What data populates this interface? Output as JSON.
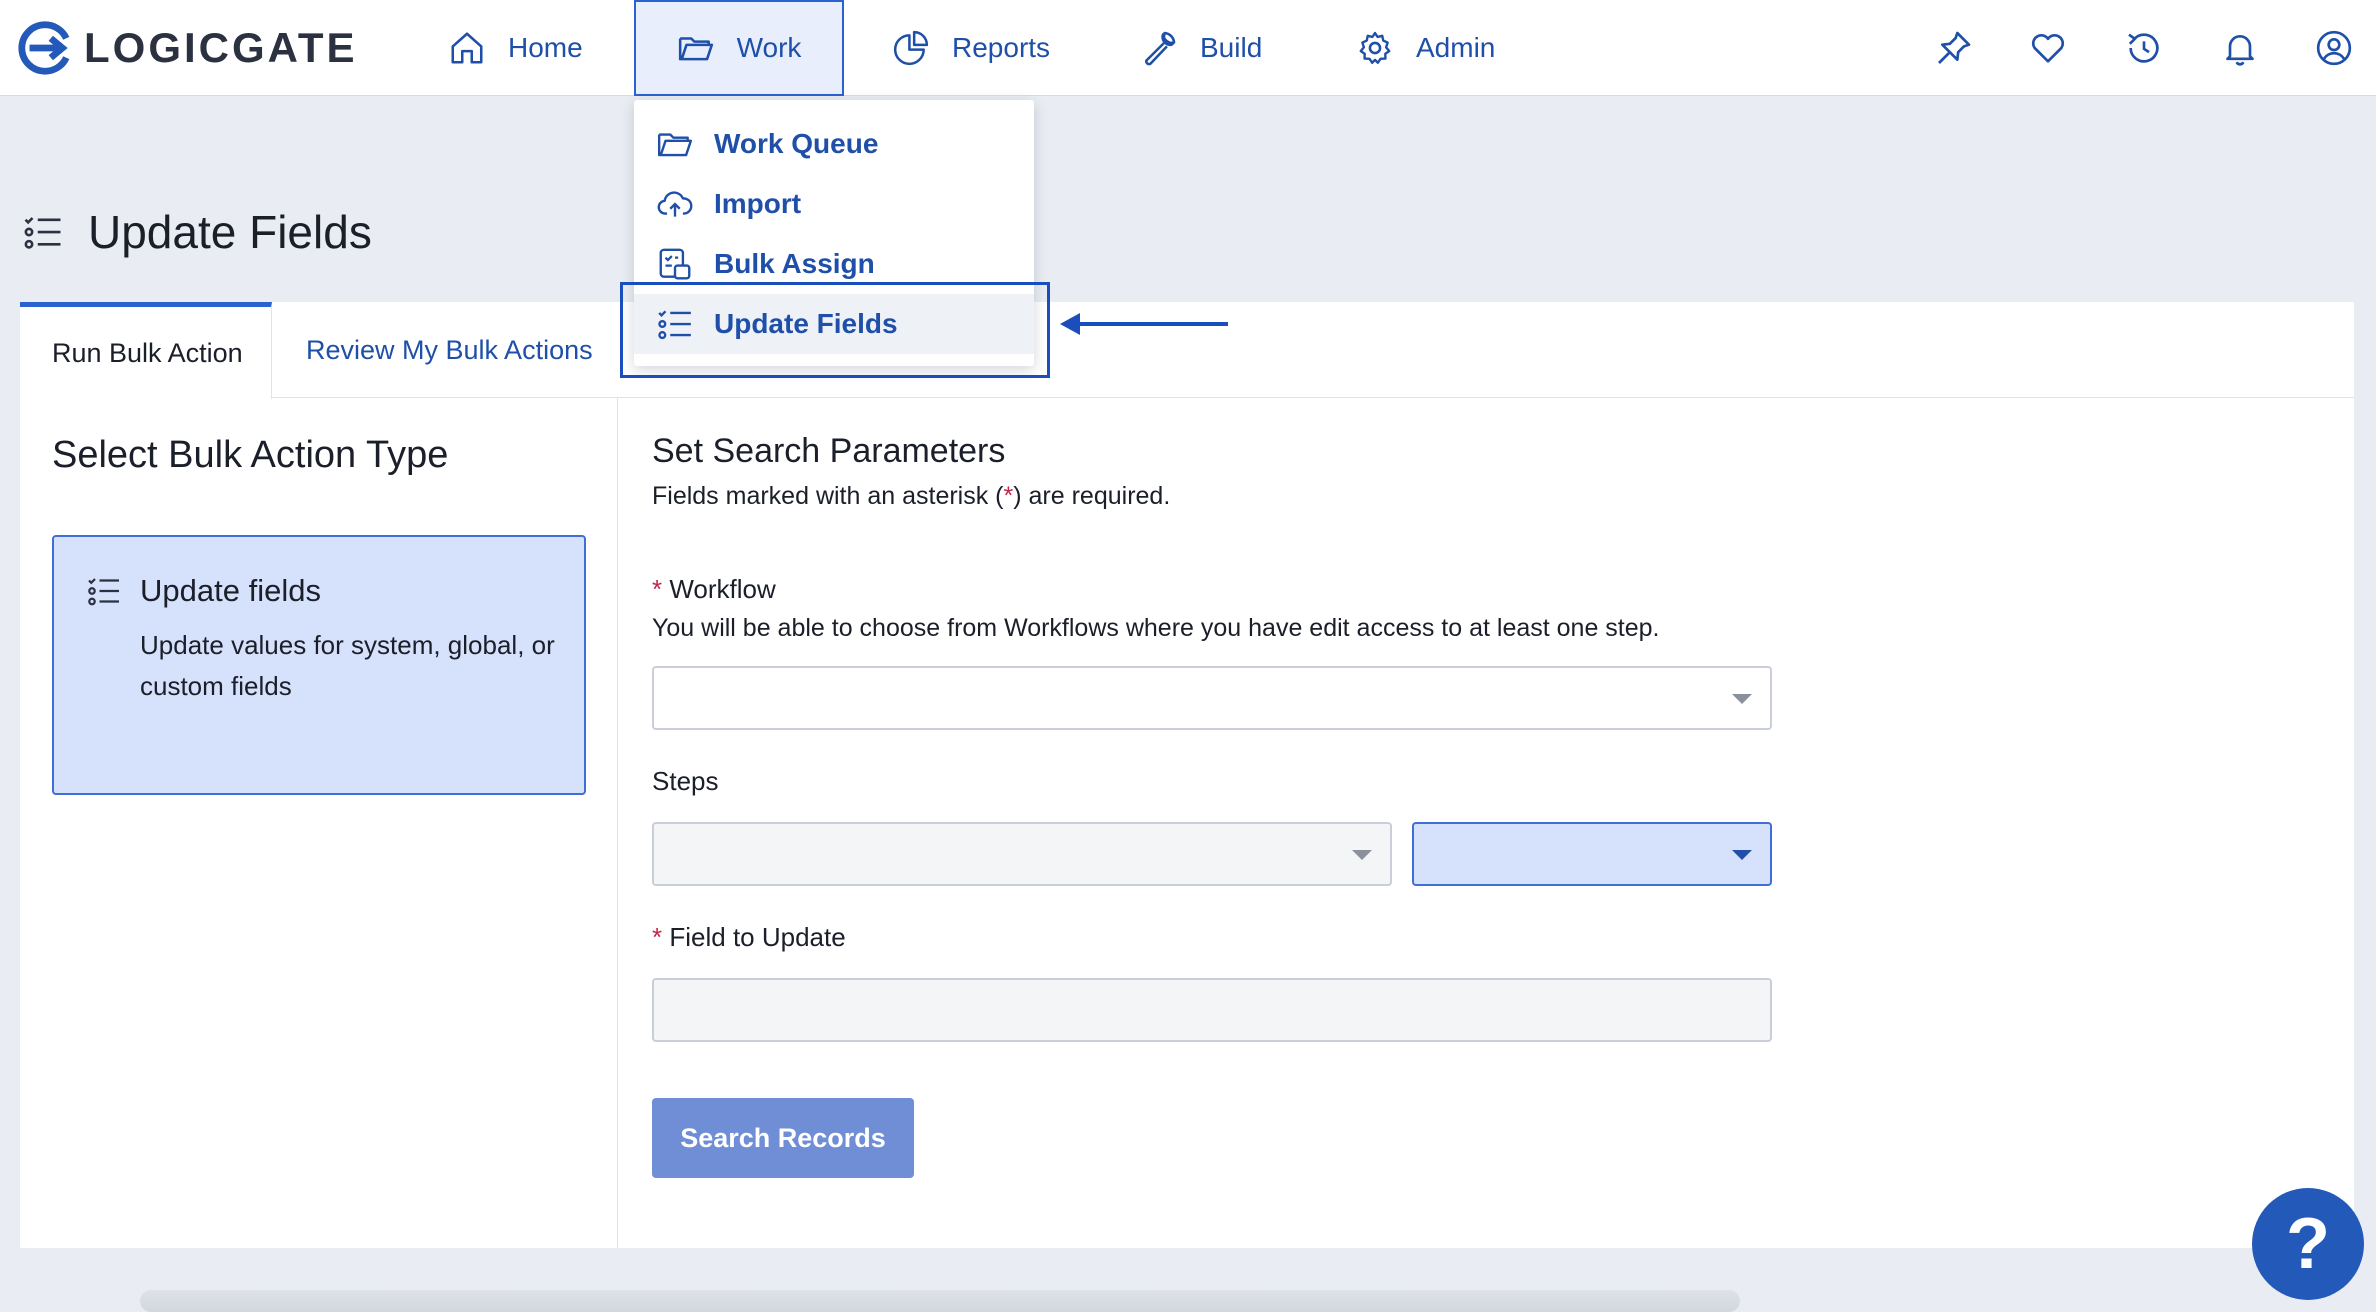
{
  "brand": {
    "name": "LOGICGATE"
  },
  "nav": {
    "items": [
      {
        "label": "Home",
        "icon": "home-icon"
      },
      {
        "label": "Work",
        "icon": "folder-icon",
        "active": true
      },
      {
        "label": "Reports",
        "icon": "pie-chart-icon"
      },
      {
        "label": "Build",
        "icon": "wrench-icon"
      },
      {
        "label": "Admin",
        "icon": "gear-icon"
      }
    ],
    "right_icons": [
      "pin-icon",
      "heart-icon",
      "history-icon",
      "bell-icon",
      "user-icon"
    ]
  },
  "work_menu": {
    "items": [
      {
        "label": "Work Queue",
        "icon": "folder-icon"
      },
      {
        "label": "Import",
        "icon": "cloud-upload-icon"
      },
      {
        "label": "Bulk Assign",
        "icon": "bulk-assign-icon"
      },
      {
        "label": "Update Fields",
        "icon": "checklist-icon",
        "highlighted": true
      }
    ]
  },
  "page": {
    "title": "Update Fields",
    "tabs": [
      "Run Bulk Action",
      "Review My Bulk Actions"
    ]
  },
  "left": {
    "heading": "Select Bulk Action Type",
    "card_title": "Update fields",
    "card_desc": "Update values for system, global, or custom fields"
  },
  "right": {
    "section_title": "Set Search Parameters",
    "required_note_pre": "Fields marked with an asterisk (",
    "required_note_star": "*",
    "required_note_post": ") are required.",
    "asterisk": "*",
    "workflow_label": "Workflow",
    "workflow_help": "You will be able to choose from Workflows where you have edit access to at least one step.",
    "workflow_value": "",
    "steps_label": "Steps",
    "steps_value": "",
    "steps_filter_value": "",
    "field_label": "Field to Update",
    "field_value": "",
    "search_button": "Search Records"
  },
  "help": {
    "label": "?"
  },
  "colors": {
    "brand_blue": "#1f4fa8",
    "accent": "#2a62cf",
    "required": "#c0264a",
    "selected_card_bg": "#d6e1fb",
    "button_bg": "#6f8ed6",
    "help_bubble": "#2359b8"
  }
}
